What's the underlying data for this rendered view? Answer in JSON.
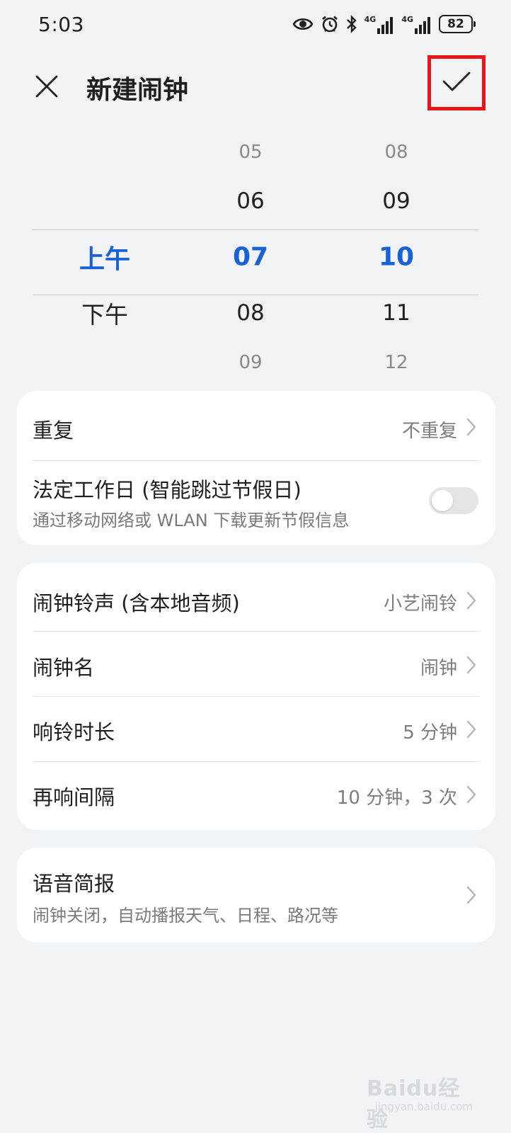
{
  "status_bar": {
    "time": "5:03",
    "network_1": "4G",
    "network_2": "4G",
    "battery": "82",
    "icons": [
      "eye-icon",
      "alarm-icon",
      "bluetooth-icon",
      "signal-icon",
      "signal-icon",
      "battery-icon"
    ]
  },
  "header": {
    "title": "新建闹钟",
    "close_icon": "close-icon",
    "confirm_icon": "check-icon",
    "highlight_color": "#e8161a"
  },
  "picker": {
    "ampm": {
      "selected": "上午",
      "below": "下午"
    },
    "hour": {
      "far_above": "05",
      "above": "06",
      "selected": "07",
      "below": "08",
      "far_below": "09"
    },
    "minute": {
      "far_above": "08",
      "above": "09",
      "selected": "10",
      "below": "11",
      "far_below": "12"
    },
    "accent_color": "#1961d6"
  },
  "card1": {
    "repeat": {
      "label": "重复",
      "value": "不重复"
    },
    "workday": {
      "label": "法定工作日 (智能跳过节假日)",
      "sub": "通过移动网络或 WLAN 下载更新节假信息",
      "enabled": false
    }
  },
  "card2": {
    "ringtone": {
      "label": "闹钟铃声 (含本地音频)",
      "value": "小艺闹铃"
    },
    "name": {
      "label": "闹钟名",
      "value": "闹钟"
    },
    "duration": {
      "label": "响铃时长",
      "value": "5 分钟"
    },
    "snooze": {
      "label": "再响间隔",
      "value": "10 分钟，3 次"
    }
  },
  "card3": {
    "briefing": {
      "label": "语音简报",
      "sub": "闹钟关闭，自动播报天气、日程、路况等"
    }
  },
  "watermark": {
    "logo": "Baidu经验",
    "url": "jingyan.baidu.com"
  }
}
